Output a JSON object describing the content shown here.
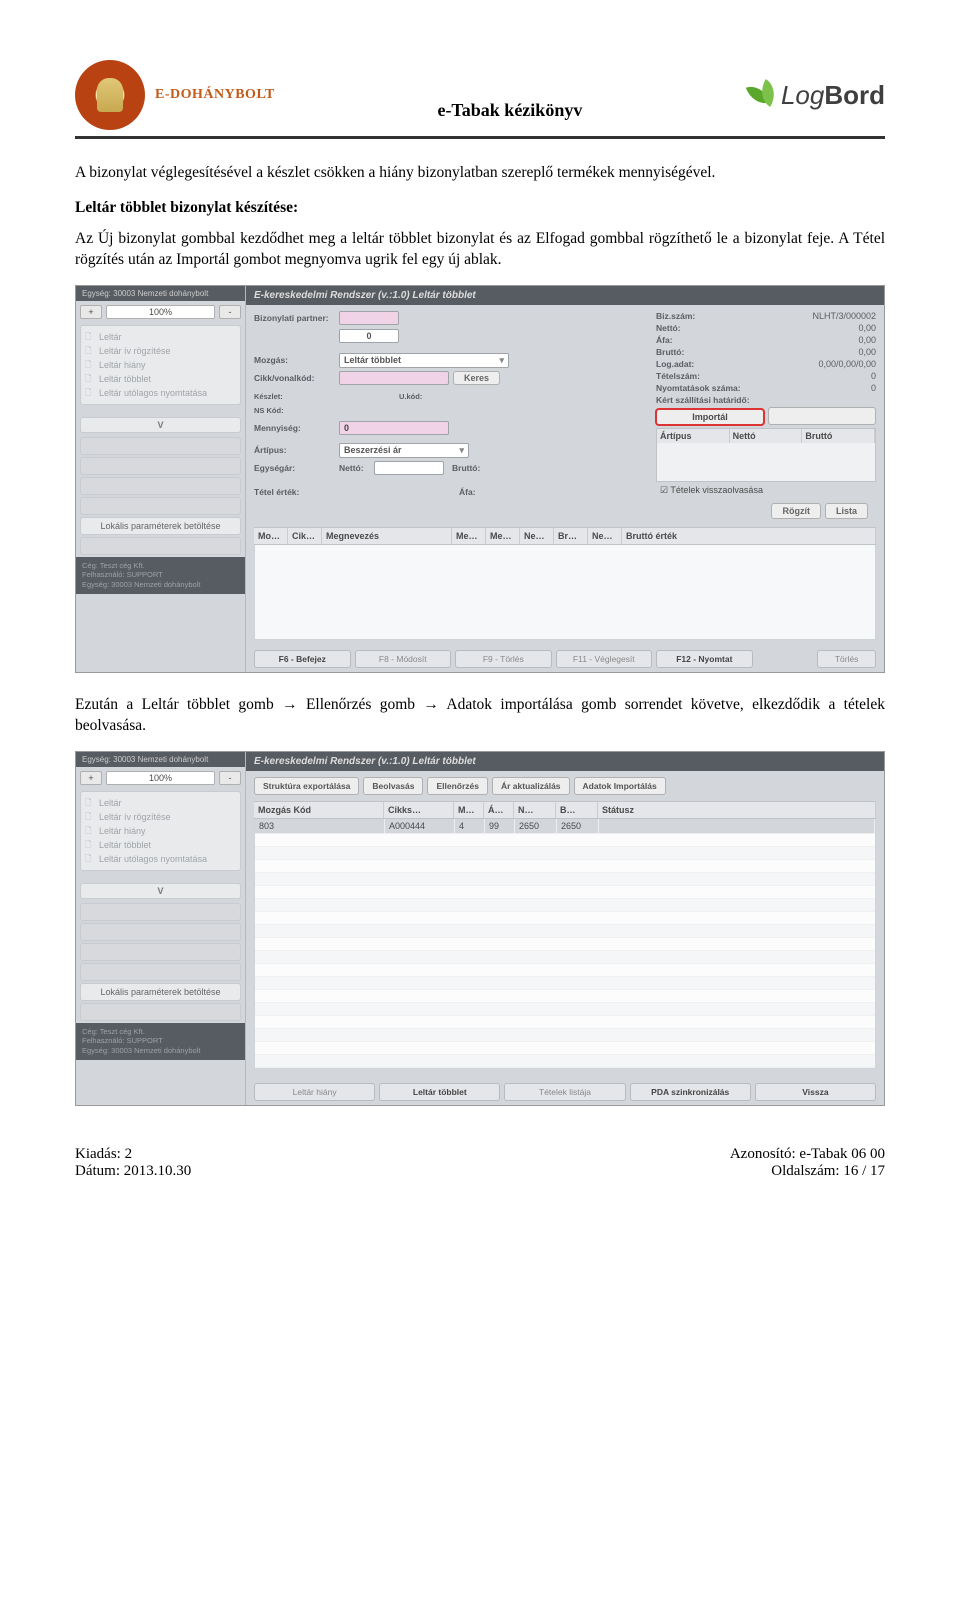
{
  "header": {
    "brand_text": "E-DOHÁNYBOLT",
    "page_title": "e-Tabak kézikönyv",
    "logbord_logo_a": "Log",
    "logbord_logo_b": "Bord"
  },
  "paragraphs": {
    "p1": "A bizonylat véglegesítésével a készlet csökken a hiány bizonylatban szereplő termékek mennyiségével.",
    "p2": "Leltár többlet bizonylat készítése:",
    "p3": "Az Új bizonylat gombbal kezdődhet meg a leltár többlet bizonylat és az Elfogad gombbal rögzíthető le a bizonylat feje. A Tétel rögzítés után az Importál gombot megnyomva ugrik fel egy új ablak.",
    "p4": "Ezután a Leltár többlet gomb → Ellenőrzés gomb → Adatok importálása gomb sorrendet követve, elkezdődik a tételek beolvasása."
  },
  "ss1": {
    "egyseg": "Egység:   30003  Nemzeti dohánybolt",
    "zoom_plus": "+",
    "zoom_val": "100%",
    "zoom_minus": "-",
    "tree": [
      "Leltár",
      "Leltár ív rögzítése",
      "Leltár hiány",
      "Leltár többlet",
      "Leltár utólagos nyomtatása"
    ],
    "down_v": "V",
    "lokalis": "Lokális paraméterek betöltése",
    "ceg": [
      "Cég: Teszt cég Kft.",
      "Felhasználó: SUPPORT",
      "Egység:   30003  Nemzeti dohánybolt"
    ],
    "title": "E-kereskedelmi Rendszer (v.:1.0)   Leltár többlet",
    "labels": {
      "biz_partner": "Bizonylati partner:",
      "mozgas": "Mozgás:",
      "mozgas_val": "Leltár többlet",
      "cikk": "Cikk/vonalkód:",
      "keres": "Keres",
      "keszlet": "Készlet:",
      "nskod": "NS Kód:",
      "ukod": "U.kód:",
      "mennyiseg": "Mennyiség:",
      "mennyiseg_val": "0",
      "artipus": "Ártípus:",
      "artipus_val": "Beszerzési ár",
      "egysegar": "Egységár:",
      "netto": "Nettó:",
      "brutto": "Bruttó:",
      "tetel_ertek": "Tétel érték:",
      "afa": "Áfa:"
    },
    "right": {
      "biz_szam_l": "Biz.szám:",
      "biz_szam_v": "NLHT/3/000002",
      "netto_l": "Nettó:",
      "netto_v": "0,00",
      "afa_l": "Áfa:",
      "afa_v": "0,00",
      "brutto_l": "Bruttó:",
      "brutto_v": "0,00",
      "log_l": "Log.adat:",
      "log_v": "0,00/0,00/0,00",
      "tetelszam_l": "Tételszám:",
      "tetelszam_v": "0",
      "nyomt_l": "Nyomtatások száma:",
      "nyomt_v": "0",
      "kert_l": "Kért szállítási határidő:",
      "importal": "Importál",
      "mini_cols": [
        "Ártípus",
        "Nettó",
        "Bruttó"
      ],
      "chk": "Tételek visszaolvasása",
      "rogzit": "Rögzít",
      "lista": "Lista"
    },
    "tbl_cols": [
      "Mo…",
      "Cik…",
      "Megnevezés",
      "Me…",
      "Me…",
      "Ne…",
      "Br…",
      "Ne…",
      "Bruttó érték"
    ],
    "fbtns": [
      "F6 - Befejez",
      "F8 - Módosít",
      "F9 - Törlés",
      "F11 - Véglegesít",
      "F12 - Nyomtat",
      "Törlés"
    ]
  },
  "ss2": {
    "egyseg": "Egység:   30003  Nemzeti dohánybolt",
    "zoom_plus": "+",
    "zoom_val": "100%",
    "zoom_minus": "-",
    "tree": [
      "Leltár",
      "Leltár ív rögzítése",
      "Leltár hiány",
      "Leltár többlet",
      "Leltár utólagos nyomtatása"
    ],
    "down_v": "V",
    "lokalis": "Lokális paraméterek betöltése",
    "ceg": [
      "Cég: Teszt cég Kft.",
      "Felhasználó: SUPPORT",
      "Egység:   30003  Nemzeti dohánybolt"
    ],
    "title": "E-kereskedelmi Rendszer (v.:1.0)   Leltár többlet",
    "toolbar": [
      "Struktúra exportálása",
      "Beolvasás",
      "Ellenőrzés",
      "Ár aktualizálás",
      "Adatok Importálás"
    ],
    "cols": [
      "Mozgás Kód",
      "Cikks…",
      "M…",
      "Á…",
      "N…",
      "B…",
      "Státusz"
    ],
    "row": [
      "803",
      "A000444",
      "4",
      "99",
      "2650",
      "2650",
      ""
    ],
    "bottom": [
      "Leltár hiány",
      "Leltár többlet",
      "Tételek listája",
      "PDA szinkronizálás",
      "Vissza"
    ]
  },
  "footer": {
    "kiadas_l": "Kiadás: 2",
    "datum_l": "Dátum: 2013.10.30",
    "azon_l": "Azonosító: e-Tabak 06 00",
    "oldal_l": "Oldalszám: 16 / 17"
  }
}
